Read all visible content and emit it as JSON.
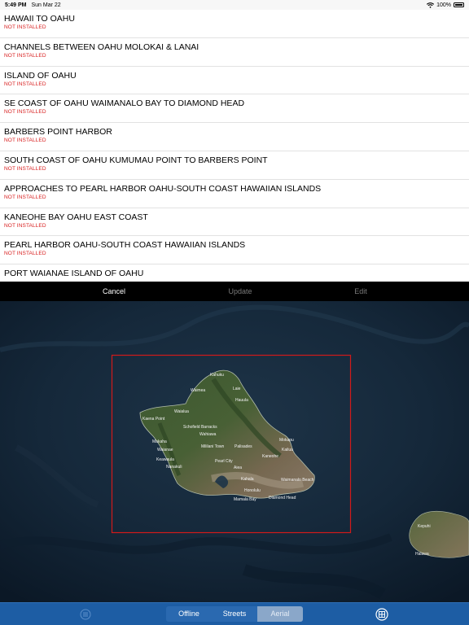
{
  "status_bar": {
    "time": "5:49 PM",
    "date": "Sun Mar 22",
    "battery": "100%"
  },
  "charts_list": [
    {
      "title": "HAWAII TO OAHU",
      "status": "NOT INSTALLED"
    },
    {
      "title": "CHANNELS BETWEEN OAHU MOLOKAI & LANAI",
      "status": "NOT INSTALLED"
    },
    {
      "title": "ISLAND OF OAHU",
      "status": "NOT INSTALLED"
    },
    {
      "title": "SE COAST OF OAHU  WAIMANALO BAY TO DIAMOND HEAD",
      "status": "NOT INSTALLED"
    },
    {
      "title": "BARBERS POINT HARBOR",
      "status": "NOT INSTALLED"
    },
    {
      "title": "SOUTH COAST OF OAHU KUMUMAU POINT TO BARBERS POINT",
      "status": "NOT INSTALLED"
    },
    {
      "title": "APPROACHES TO PEARL HARBOR  OAHU-SOUTH COAST  HAWAIIAN ISLANDS",
      "status": "NOT INSTALLED"
    },
    {
      "title": "KANEOHE BAY  OAHU EAST COAST",
      "status": "NOT INSTALLED"
    },
    {
      "title": "PEARL HARBOR  OAHU-SOUTH COAST  HAWAIIAN ISLANDS",
      "status": "NOT INSTALLED"
    },
    {
      "title": "PORT WAIANAE  ISLAND OF OAHU",
      "status": ""
    }
  ],
  "toolbar": {
    "cancel": "Cancel",
    "update": "Update",
    "edit": "Edit"
  },
  "map": {
    "labels": [
      "Waimea",
      "Laie",
      "Hauula",
      "Waialua",
      "Kaena Point",
      "Schofield Barracks",
      "Mililani Town",
      "Wahiawa",
      "Kahuku",
      "Makaha",
      "Waianae",
      "Nanakuli",
      "Pearl City",
      "Aiea",
      "Kaneohe",
      "Kailua",
      "Waimanalo Beach",
      "Honolulu",
      "Mamala Bay",
      "Diamond Head",
      "Mokapu",
      "Keawaula",
      "Kepuhi",
      "Halawa",
      "Kahala",
      "Palisades"
    ],
    "selection_color": "#d11a1a"
  },
  "tabbar": {
    "segments": [
      "Offline",
      "Streets",
      "Aerial"
    ],
    "selected": "Aerial"
  }
}
